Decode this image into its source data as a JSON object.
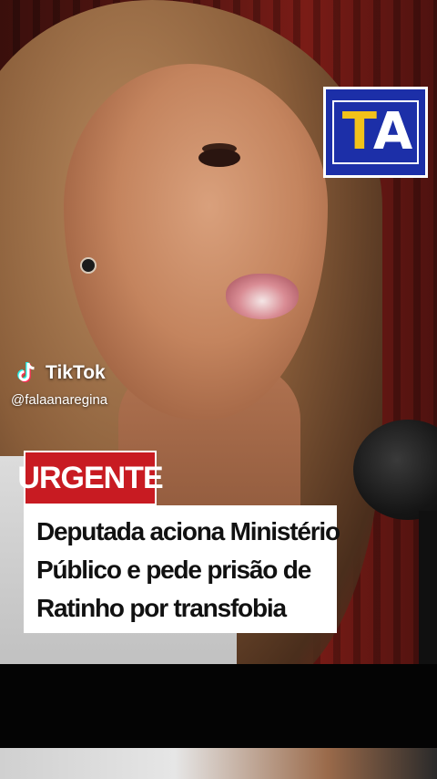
{
  "logo": {
    "letter_t": "T",
    "letter_a": "A",
    "bg_color": "#1c2fa8",
    "t_color": "#f2c21a"
  },
  "tiktok": {
    "brand": "TikTok",
    "username": "@falaanaregina"
  },
  "headline": {
    "badge": "URGENTE",
    "badge_color": "#c81b22",
    "lines": [
      "Deputada aciona Ministério",
      "Público e pede prisão de",
      "Ratinho por transfobia"
    ]
  }
}
